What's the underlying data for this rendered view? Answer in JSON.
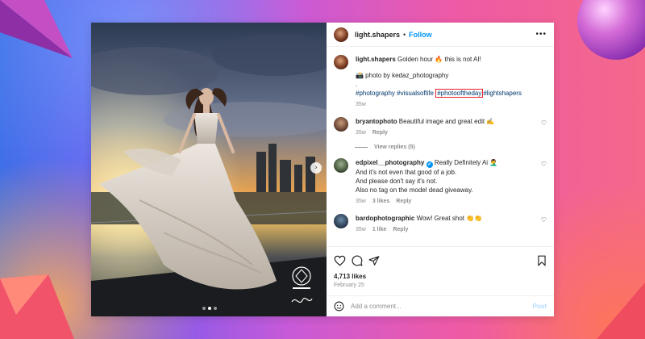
{
  "colors": {
    "accent": "#0095f6",
    "highlight": "#e8202a",
    "hashtag": "#00376b"
  },
  "header": {
    "username": "light.shapers",
    "separator": "•",
    "follow_label": "Follow",
    "more_icon": "more-horizontal-icon"
  },
  "caption": {
    "username": "light.shapers",
    "text": "Golden hour 🔥 this is not AI!",
    "credit": "📸 photo by kedaz_photography",
    "dot": ".",
    "tags_before": "#photography #visualsoflife",
    "tag_highlighted": "#photooftheday",
    "tags_after": "#lightshapers",
    "age": "35w"
  },
  "comments": [
    {
      "username": "bryantophoto",
      "text": "Beautiful image and great edit ✍️",
      "age": "35w",
      "reply_label": "Reply",
      "view_replies": "View replies (5)"
    },
    {
      "username": "edpixel__photography",
      "verified": "✔",
      "lines": [
        "Really Definitely Ai 🤦‍♂️",
        "And it's not even that good of a job.",
        "And please don't say it's not.",
        "Also no tag on the model dead giveaway."
      ],
      "age": "35w",
      "likes": "3 likes",
      "reply_label": "Reply"
    },
    {
      "username": "bardophotographic",
      "text": "Wow! Great shot 👏👏",
      "age": "35w",
      "likes": "1 like",
      "reply_label": "Reply"
    }
  ],
  "actions": {
    "like_icon": "heart-icon",
    "comment_icon": "comment-icon",
    "share_icon": "send-icon",
    "save_icon": "bookmark-icon"
  },
  "likes": "4,713 likes",
  "date": "February 25",
  "add_comment": {
    "placeholder": "Add a comment...",
    "post_label": "Post",
    "emoji_icon": "emoji-icon"
  },
  "media": {
    "next_arrow": "›",
    "slides": 3,
    "active_slide": 2
  }
}
